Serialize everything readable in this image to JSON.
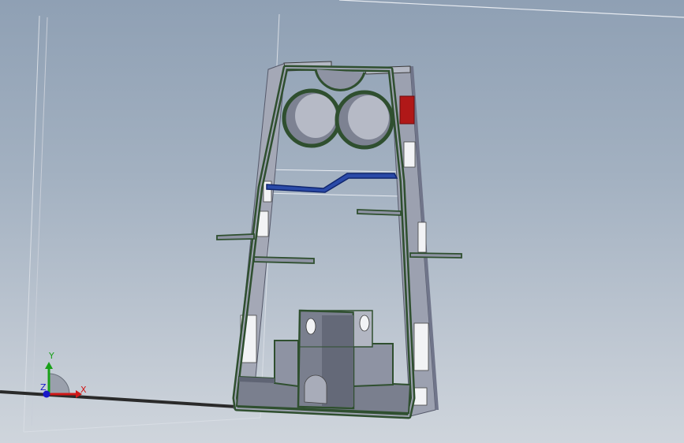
{
  "viewport": {
    "background_top": "#8fa0b4",
    "background_bottom": "#cfd5dc"
  },
  "colors": {
    "body_face": "#8e93a3",
    "body_face_light": "#a6aab7",
    "body_face_dark": "#6f7484",
    "edge_outline": "#2f4f2f",
    "selected_edge": "#1f3fa0",
    "highlight_face": "#b01818",
    "axis_x": "#d01818",
    "axis_y": "#18a018",
    "axis_z": "#1818c8"
  },
  "triad": {
    "x_label": "X",
    "y_label": "Y",
    "z_label": "Z",
    "icons": [
      "x-axis-arrow-icon",
      "y-axis-arrow-icon",
      "z-axis-arrow-icon"
    ]
  }
}
